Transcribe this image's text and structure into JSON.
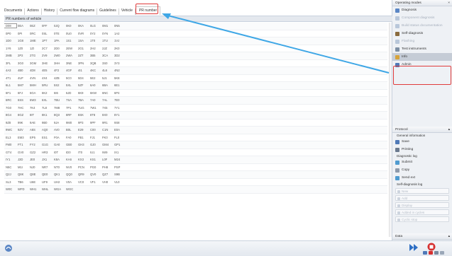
{
  "tabs": [
    "Documents",
    "Actions",
    "History",
    "Current flow diagrams",
    "Guidelines",
    "Vehicle",
    "PR number"
  ],
  "panel_header": "PR numbers of vehicle",
  "pr_rows": [
    [
      "D08",
      "0EA",
      "0EZ",
      "0FF",
      "0JQ",
      "0K0",
      "0KA",
      "0LG",
      "0M1",
      "0N5"
    ],
    [
      "0P0",
      "0PI",
      "0RC",
      "0SL",
      "0TE",
      "0U0",
      "0VR",
      "0Y2",
      "0YN",
      "1A2"
    ],
    [
      "1D0",
      "1G8",
      "1ME",
      "1P7",
      "1PA",
      "1S1",
      "1SA",
      "1T0",
      "1TU",
      "1VJ"
    ],
    [
      "1Y6",
      "1Z0",
      "1ZI",
      "2C7",
      "2D0",
      "2EW",
      "2G1",
      "2H2",
      "2JZ",
      "2K0"
    ],
    [
      "2MB",
      "2P2",
      "2TG",
      "2V9",
      "2W0",
      "2WA",
      "2ZT",
      "3B5",
      "3CA",
      "3D2"
    ],
    [
      "3FL",
      "3G0",
      "3GM",
      "3HE",
      "3HH",
      "3NE",
      "3PN",
      "3QB",
      "3S0",
      "3Y3"
    ],
    [
      "4A3",
      "4B0",
      "4D8",
      "4E5",
      "4F2",
      "4GF",
      "4I1",
      "4KC",
      "4L6",
      "4N2"
    ],
    [
      "4T1",
      "4UF",
      "4VN",
      "4X4",
      "4ZB",
      "5C0",
      "5D4",
      "5E2",
      "5J1",
      "5K8"
    ],
    [
      "6L1",
      "5M7",
      "5MH",
      "5RU",
      "5S2",
      "5XL",
      "5ZF",
      "6A0",
      "6BA",
      "6E1"
    ],
    [
      "6F1",
      "6FJ",
      "6GA",
      "6K2",
      "6I6",
      "6JD",
      "6K9",
      "6KW",
      "6NC",
      "6P4"
    ],
    [
      "6RC",
      "6SS",
      "6W3",
      "6XL",
      "7BU",
      "7SA",
      "7BA",
      "7A0",
      "7AL",
      "7E0"
    ],
    [
      "7G0",
      "7HC",
      "7K4",
      "7L8",
      "7M8",
      "7P1",
      "7UG",
      "7W1",
      "7X5",
      "7Y1"
    ],
    [
      "8G4",
      "8GZ",
      "8IT",
      "8K1",
      "8Q3",
      "8RF",
      "8SK",
      "8T8",
      "8X0",
      "8Y1"
    ],
    [
      "9Z8",
      "99K",
      "9AE",
      "9B0",
      "9JA",
      "9M0",
      "9P3",
      "9PF",
      "9R1",
      "9S8"
    ],
    [
      "9WC",
      "9ZV",
      "A8S",
      "AQ0",
      "AV0",
      "B0L",
      "E29",
      "C00",
      "C1N",
      "E0A"
    ],
    [
      "EL3",
      "EM3",
      "EP5",
      "ES1",
      "F0A",
      "FA0",
      "FB1",
      "FJ1",
      "FK0",
      "FL0"
    ],
    [
      "FM0",
      "FT1",
      "FY2",
      "G1G",
      "GA0",
      "GB0",
      "GH3",
      "GJ0",
      "GM4",
      "GP1"
    ],
    [
      "GT4",
      "GV0",
      "GZ2",
      "HR3",
      "I0T",
      "ID0",
      "IT0",
      "IU1",
      "IW9",
      "IX1"
    ],
    [
      "IY1",
      "J2D",
      "JE0",
      "JX1",
      "K8A",
      "KA6",
      "KX3",
      "KS1",
      "L0F",
      "M24"
    ],
    [
      "N5C",
      "M1I",
      "NJ0",
      "NR7",
      "NT0",
      "NV0",
      "PCN",
      "PG0",
      "PH8",
      "PSP"
    ],
    [
      "Q2J",
      "Q8K",
      "Q8E",
      "QE0",
      "QK1",
      "QQ0",
      "QR9",
      "QV0",
      "QZ7",
      "S9B"
    ],
    [
      "SL3",
      "TB6",
      "U6E",
      "UF9",
      "UH2",
      "V0A",
      "VC0",
      "VF1",
      "VH0",
      "VL0"
    ],
    [
      "W0C",
      "WFD",
      "WH1",
      "WHL",
      "WGA",
      "WGC",
      "",
      "",
      "",
      ""
    ]
  ],
  "right_panel": {
    "operating_modes_title": "Operating modes",
    "close_glyph": "×",
    "items": [
      {
        "label": "Diagnosis",
        "dim": false,
        "icon": "diagnosis-icon",
        "color": "#5a86c5"
      },
      {
        "label": "Component diagnosis",
        "dim": true,
        "icon": "component-diagnosis-icon",
        "color": "#b9c7da"
      },
      {
        "label": "Build status documentation",
        "dim": true,
        "icon": "build-status-icon",
        "color": "#b9c7da"
      },
      {
        "label": "Self-diagnosis",
        "dim": false,
        "icon": "self-diagnosis-icon",
        "color": "#8a6b3e"
      },
      {
        "label": "Flashing",
        "dim": true,
        "icon": "flashing-icon",
        "color": "#b9c7da"
      },
      {
        "label": "Test instruments",
        "dim": false,
        "icon": "test-instruments-icon",
        "color": "#7d8fa5"
      },
      {
        "label": "Info",
        "dim": false,
        "icon": "info-icon",
        "color": "#d7a33b",
        "selected": true
      },
      {
        "label": "Admin",
        "dim": false,
        "icon": "admin-icon",
        "color": "#4f79b8"
      }
    ],
    "protocol_title": "Protocol",
    "general_information": "General information",
    "save_label": "Save",
    "printing_label": "Printing",
    "diagnostic_log": "Diagnostic log",
    "submit_label": "Submit",
    "copy_label": "Copy",
    "send_ext_label": "Send ext",
    "self_diagnosis_log": "Self-diagnosis log",
    "new_label": "New",
    "add_label": "Add",
    "display_label": "Display",
    "added_in_cycles_label": "Added in cycles",
    "cyclic_stop_label": "Cyclic stop",
    "data_title": "Data",
    "collapse_glyph": "▴"
  },
  "colors": {
    "highlight": "#e03b3b",
    "arrow": "#3fa7e6",
    "selected_bg": "#c5ccd6"
  }
}
